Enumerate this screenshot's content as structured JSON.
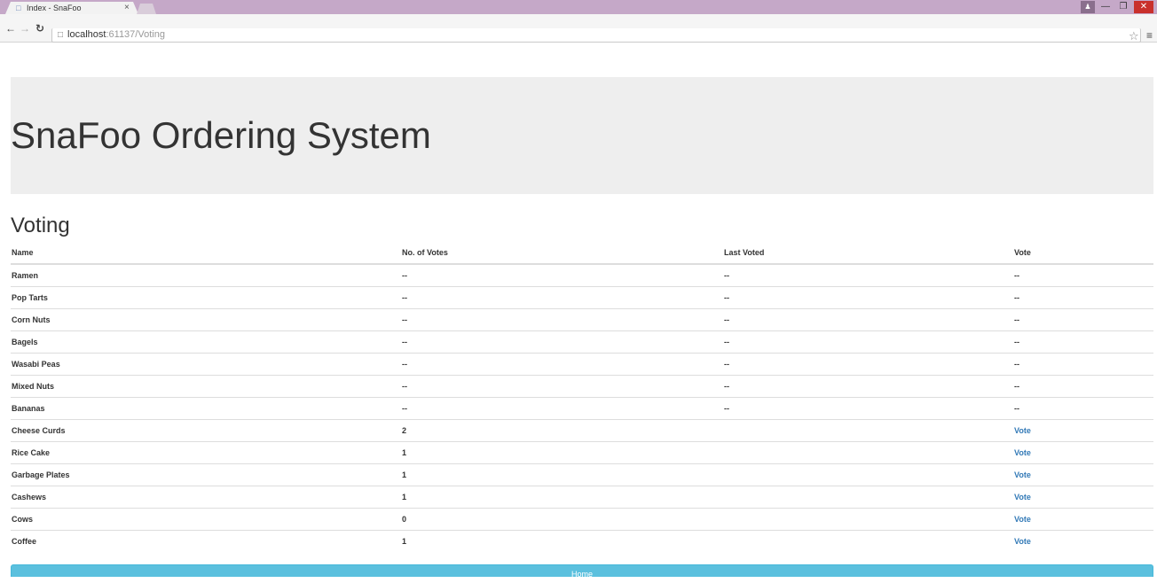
{
  "browser": {
    "tab_title": "Index - SnaFoo",
    "tab_close": "×",
    "url_host": "localhost",
    "url_rest": ":61137/Voting"
  },
  "page": {
    "heading": "SnaFoo Ordering System",
    "section_title": "Voting",
    "home_label": "Home"
  },
  "table": {
    "headers": [
      "Name",
      "No. of Votes",
      "Last Voted",
      "Vote"
    ],
    "rows": [
      {
        "name": "Ramen",
        "votes": "--",
        "last": "--",
        "vote": "--"
      },
      {
        "name": "Pop Tarts",
        "votes": "--",
        "last": "--",
        "vote": "--"
      },
      {
        "name": "Corn Nuts",
        "votes": "--",
        "last": "--",
        "vote": "--"
      },
      {
        "name": "Bagels",
        "votes": "--",
        "last": "--",
        "vote": "--"
      },
      {
        "name": "Wasabi Peas",
        "votes": "--",
        "last": "--",
        "vote": "--"
      },
      {
        "name": "Mixed Nuts",
        "votes": "--",
        "last": "--",
        "vote": "--"
      },
      {
        "name": "Bananas",
        "votes": "--",
        "last": "--",
        "vote": "--"
      },
      {
        "name": "Cheese Curds",
        "votes": "2",
        "last": "",
        "vote": "Vote"
      },
      {
        "name": "Rice Cake",
        "votes": "1",
        "last": "",
        "vote": "Vote"
      },
      {
        "name": "Garbage Plates",
        "votes": "1",
        "last": "",
        "vote": "Vote"
      },
      {
        "name": "Cashews",
        "votes": "1",
        "last": "",
        "vote": "Vote"
      },
      {
        "name": "Cows",
        "votes": "0",
        "last": "",
        "vote": "Vote"
      },
      {
        "name": "Coffee",
        "votes": "1",
        "last": "",
        "vote": "Vote"
      }
    ]
  },
  "colors": {
    "jumbotron_bg": "#eeeeee",
    "link": "#337ab7",
    "info_button": "#5bc0de",
    "tabstrip": "#c5a8c8"
  },
  "icons": {
    "back": "arrow-left-icon",
    "forward": "arrow-right-icon",
    "reload": "reload-icon",
    "page": "page-icon",
    "star": "star-icon",
    "menu": "hamburger-menu-icon"
  }
}
